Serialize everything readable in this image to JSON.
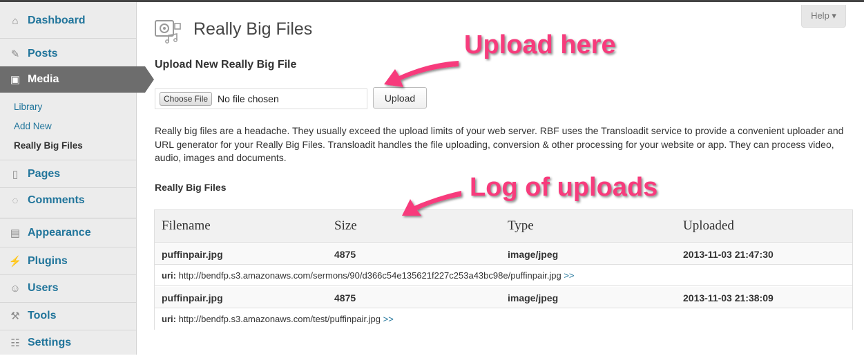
{
  "sidebar": {
    "dashboard": "Dashboard",
    "posts": "Posts",
    "media": "Media",
    "media_sub": [
      "Library",
      "Add New",
      "Really Big Files"
    ],
    "pages": "Pages",
    "comments": "Comments",
    "appearance": "Appearance",
    "plugins": "Plugins",
    "users": "Users",
    "tools": "Tools",
    "settings": "Settings"
  },
  "header": {
    "help": "Help ▾",
    "title": "Really Big Files"
  },
  "upload": {
    "heading": "Upload New Really Big File",
    "choose_label": "Choose File",
    "no_file": "No file chosen",
    "button": "Upload"
  },
  "description": "Really big files are a headache. They usually exceed the upload limits of your web server. RBF uses the Transloadit service to provide a convenient uploader and URL generator for your Really Big Files. Transloadit handles the file uploading, conversion & other processing for your website or app. They can process video, audio, images and documents.",
  "files": {
    "heading": "Really Big Files",
    "columns": [
      "Filename",
      "Size",
      "Type",
      "Uploaded"
    ],
    "uri_label": "uri:",
    "more_link": ">>",
    "rows": [
      {
        "filename": "puffinpair.jpg",
        "size": "4875",
        "type": "image/jpeg",
        "uploaded": "2013-11-03 21:47:30",
        "uri": "http://bendfp.s3.amazonaws.com/sermons/90/d366c54e135621f227c253a43bc98e/puffinpair.jpg"
      },
      {
        "filename": "puffinpair.jpg",
        "size": "4875",
        "type": "image/jpeg",
        "uploaded": "2013-11-03 21:38:09",
        "uri": "http://bendfp.s3.amazonaws.com/test/puffinpair.jpg"
      }
    ]
  },
  "annotations": {
    "upload_here": "Upload here",
    "log_of_uploads": "Log of uploads",
    "color": "#f73b7c"
  },
  "colors": {
    "link": "#21759b",
    "active_menu": "#6d6d6d",
    "sidebar_bg": "#ececec"
  }
}
